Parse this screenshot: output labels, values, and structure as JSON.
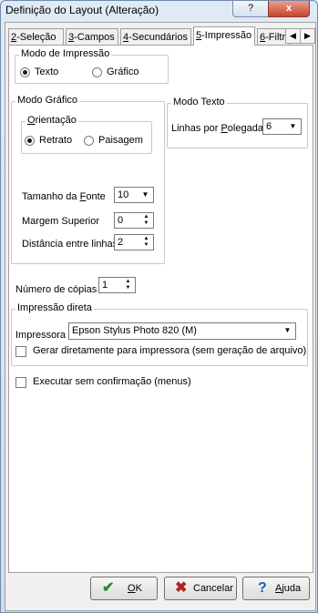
{
  "window": {
    "title": "Definição do Layout (Alteração)",
    "help_label": "?",
    "close_label": "x"
  },
  "tabs": [
    {
      "key": "2",
      "rest": "-Seleção"
    },
    {
      "key": "3",
      "rest": "-Campos"
    },
    {
      "key": "4",
      "rest": "-Secundários"
    },
    {
      "key": "5",
      "rest": "-Impressão"
    },
    {
      "key": "6",
      "rest": "-Filtro"
    }
  ],
  "tab_scroll": {
    "left": "◀",
    "right": "▶"
  },
  "modo_impressao": {
    "legend": "Modo de Impressão",
    "texto": "Texto",
    "grafico": "Gráfico",
    "selected": "Texto"
  },
  "modo_grafico": {
    "legend": "Modo Gráfico",
    "orientacao": {
      "legend_key": "O",
      "legend_rest": "rientação",
      "retrato": "Retrato",
      "paisagem": "Paisagem",
      "selected": "Retrato"
    },
    "tamanho_fonte": {
      "label_pre": "Tamanho da ",
      "label_key": "F",
      "label_rest": "onte",
      "value": "10"
    },
    "margem_superior": {
      "label": "Margem Superior",
      "value": "0"
    },
    "distancia_linhas": {
      "label": "Distância entre linhas",
      "value": "2"
    }
  },
  "modo_texto": {
    "legend": "Modo Texto",
    "linhas_label_pre": "Linhas por ",
    "linhas_label_key": "P",
    "linhas_label_rest": "olegada",
    "linhas_value": "6"
  },
  "numero_copias": {
    "label": "Número de cópias",
    "value": "1"
  },
  "impressao_direta": {
    "legend": "Impressão direta",
    "impressora_label": "Impressora",
    "impressora_value": "Epson Stylus Photo 820 (M)",
    "gerar_label": "Gerar diretamente para impressora (sem geração de arquivo)",
    "gerar_checked": false
  },
  "executar": {
    "label": "Executar sem confirmação (menus)",
    "checked": false
  },
  "buttons": {
    "ok_key": "O",
    "ok_rest": "K",
    "cancelar": "Cancelar",
    "ajuda_key": "A",
    "ajuda_rest": "juda"
  },
  "colors": {
    "ok_icon": "#2e8b2e",
    "cancel_icon": "#b22222",
    "help_icon": "#1f5fbf"
  }
}
